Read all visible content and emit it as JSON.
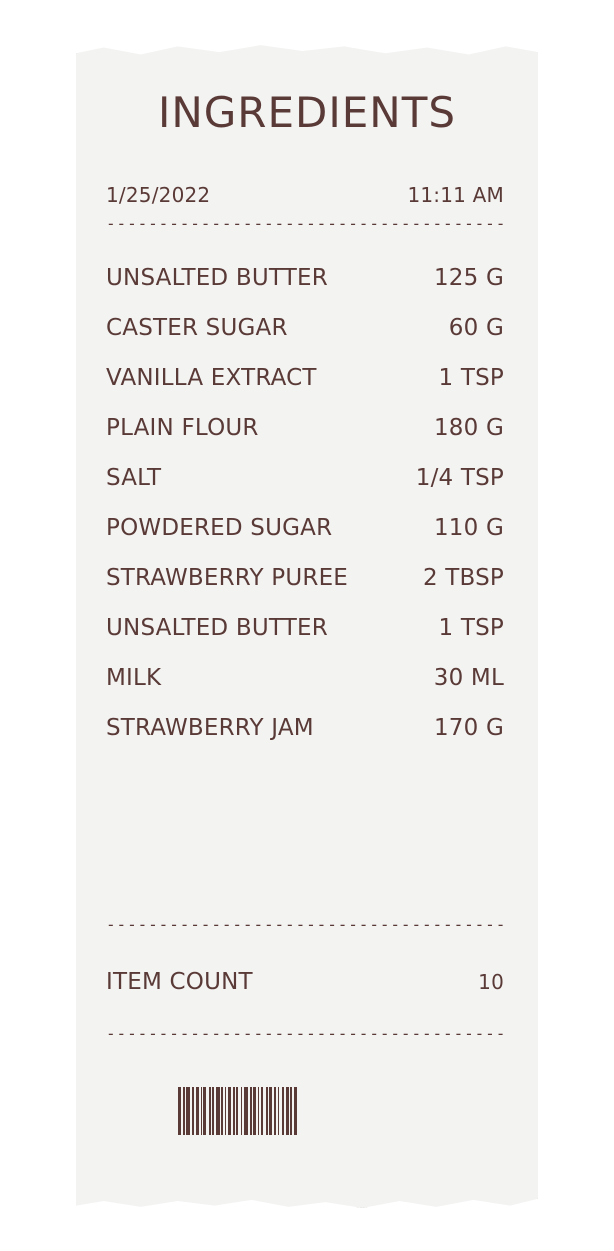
{
  "receipt": {
    "title": "INGREDIENTS",
    "date": "1/25/2022",
    "time": "11:11 AM",
    "separator": "-----------------------------------------------------------",
    "items": [
      {
        "name": "UNSALTED BUTTER",
        "qty": "125 G"
      },
      {
        "name": "CASTER SUGAR",
        "qty": "60 G"
      },
      {
        "name": "VANILLA EXTRACT",
        "qty": "1 TSP"
      },
      {
        "name": "PLAIN FLOUR",
        "qty": "180 G"
      },
      {
        "name": "SALT",
        "qty": "1/4 TSP"
      },
      {
        "name": "POWDERED SUGAR",
        "qty": "110 G"
      },
      {
        "name": "STRAWBERRY PUREE",
        "qty": "2 TBSP"
      },
      {
        "name": "UNSALTED BUTTER",
        "qty": "1 TSP"
      },
      {
        "name": "MILK",
        "qty": "30 ML"
      },
      {
        "name": "STRAWBERRY JAM",
        "qty": "170 G"
      }
    ],
    "item_count_label": "ITEM COUNT",
    "item_count": "10"
  },
  "colors": {
    "ink": "#5a3a37",
    "paper": "#f3f3f2"
  }
}
